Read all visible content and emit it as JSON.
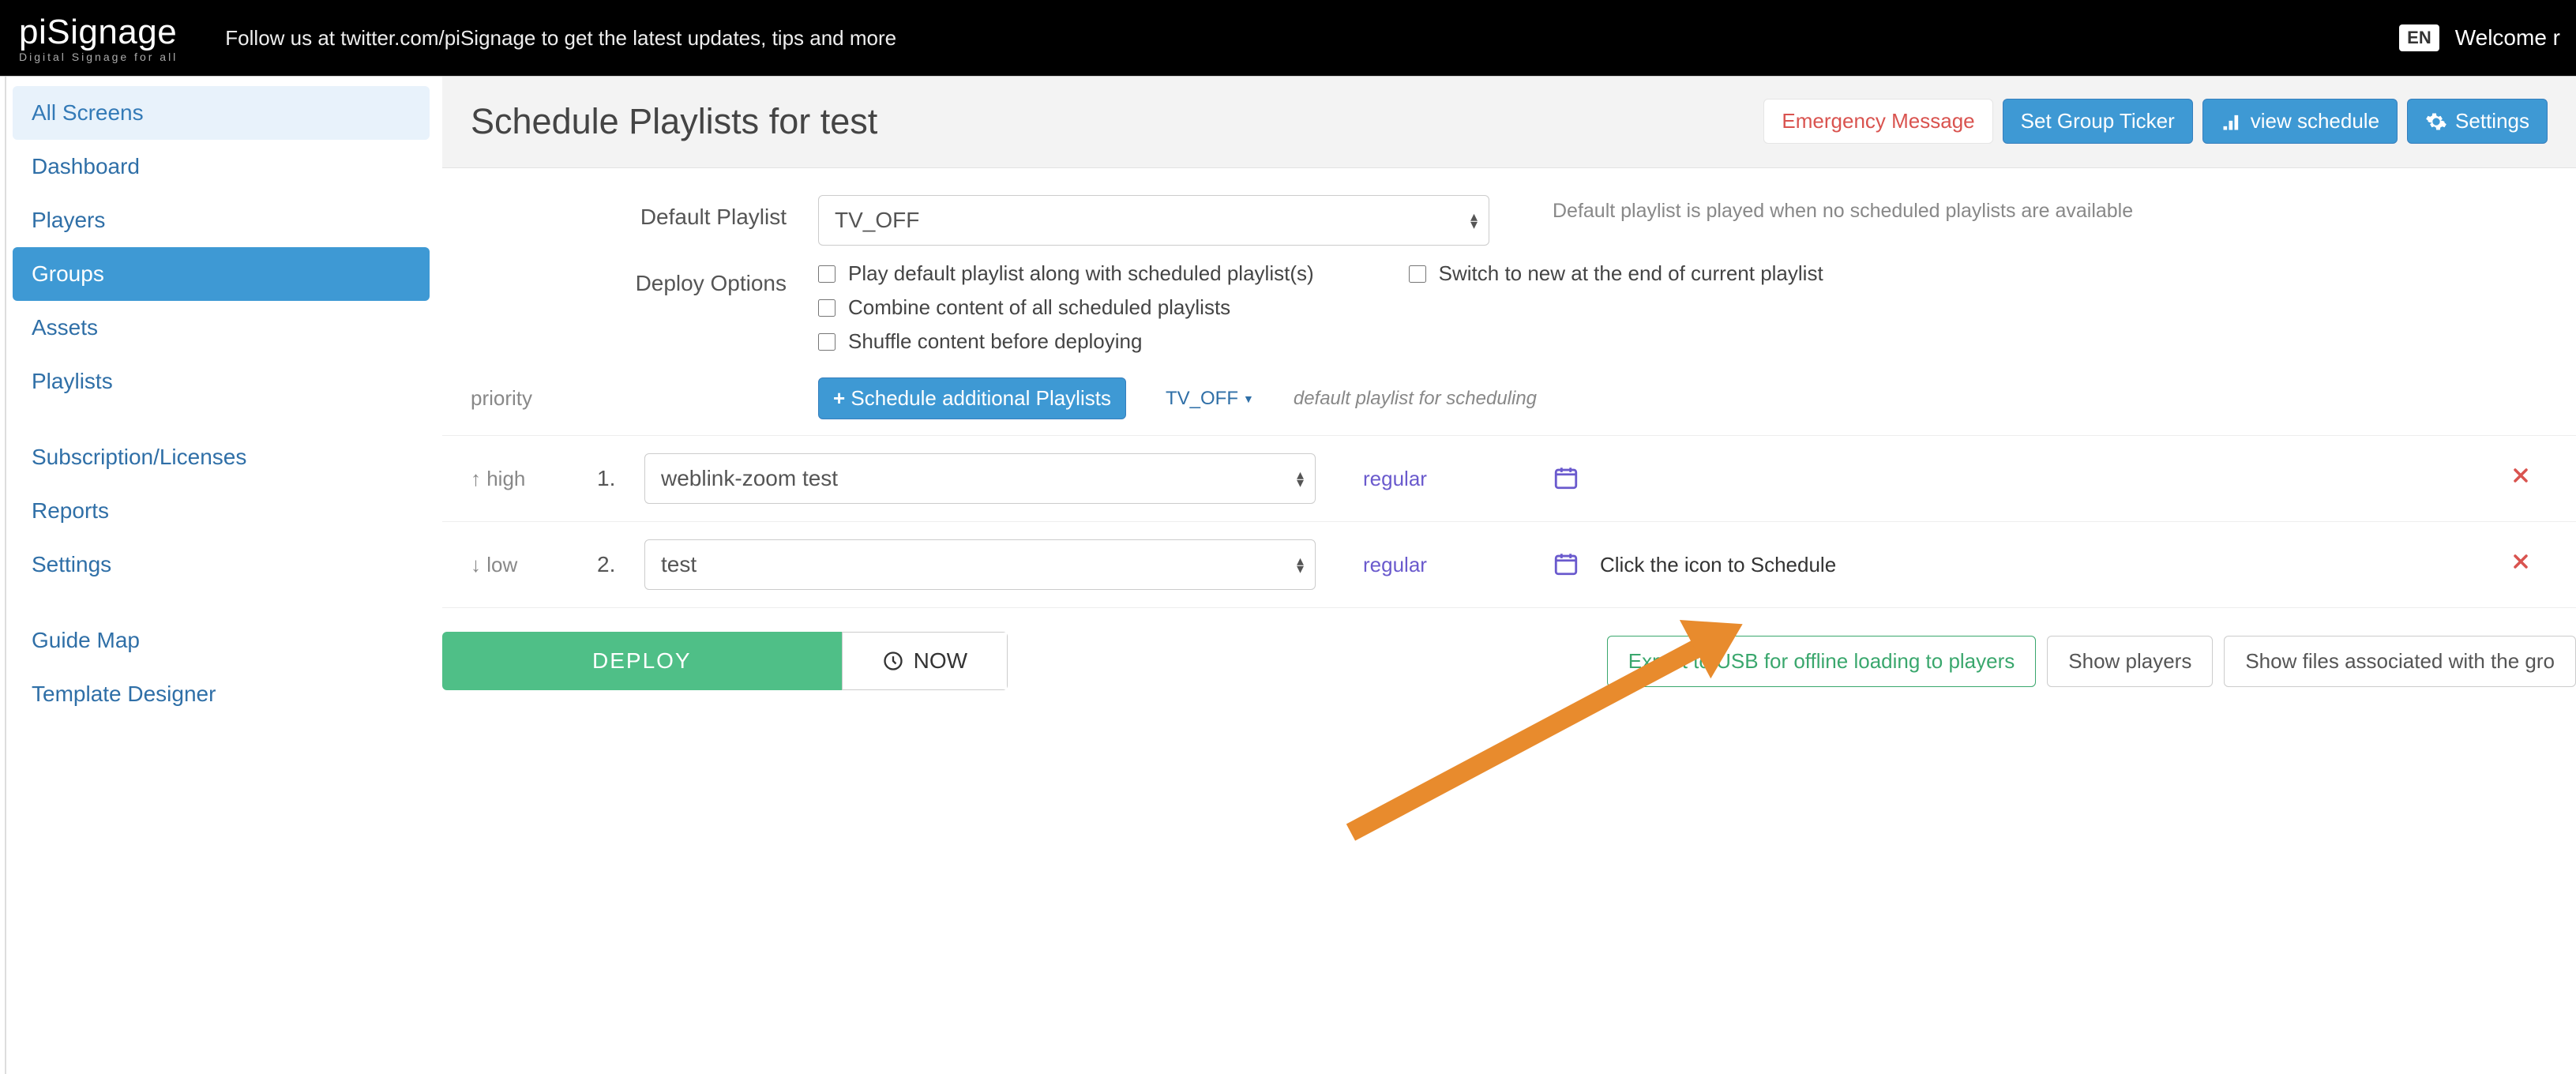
{
  "topbar": {
    "logo_main": "piSignage",
    "logo_sub": "Digital Signage for all",
    "follow_msg": "Follow us at twitter.com/piSignage to get the latest updates, tips and more",
    "lang": "EN",
    "welcome": "Welcome r"
  },
  "sidebar": {
    "items": [
      {
        "label": "All Screens",
        "state": "active"
      },
      {
        "label": "Dashboard"
      },
      {
        "label": "Players"
      },
      {
        "label": "Groups",
        "state": "selected"
      },
      {
        "label": "Assets"
      },
      {
        "label": "Playlists"
      }
    ],
    "items2": [
      {
        "label": "Subscription/Licenses"
      },
      {
        "label": "Reports"
      },
      {
        "label": "Settings"
      }
    ],
    "items3": [
      {
        "label": "Guide Map"
      },
      {
        "label": "Template Designer"
      }
    ]
  },
  "header": {
    "title": "Schedule Playlists for test",
    "emergency": "Emergency Message",
    "ticker": "Set Group Ticker",
    "view_schedule": "view schedule",
    "settings": "Settings"
  },
  "form": {
    "default_label": "Default Playlist",
    "default_value": "TV_OFF",
    "default_hint": "Default playlist is played when no scheduled playlists are available",
    "deploy_label": "Deploy Options",
    "opt_play_default": "Play default playlist along with scheduled playlist(s)",
    "opt_switch_new": "Switch to new at the end of current playlist",
    "opt_combine": "Combine content of all scheduled playlists",
    "opt_shuffle": "Shuffle content before deploying"
  },
  "priority": {
    "label": "priority",
    "schedule_btn": "Schedule additional Playlists",
    "dd_label": "TV_OFF",
    "dd_hint": "default playlist for scheduling"
  },
  "rows": [
    {
      "pri": "↑ high",
      "num": "1.",
      "value": "weblink-zoom test",
      "type": "regular",
      "hint": ""
    },
    {
      "pri": "↓ low",
      "num": "2.",
      "value": "test",
      "type": "regular",
      "hint": "Click the icon to Schedule"
    }
  ],
  "footer": {
    "deploy": "DEPLOY",
    "now": "NOW",
    "export": "Export to USB for offline loading to players",
    "show_players": "Show players",
    "show_files": "Show files associated with the gro"
  }
}
